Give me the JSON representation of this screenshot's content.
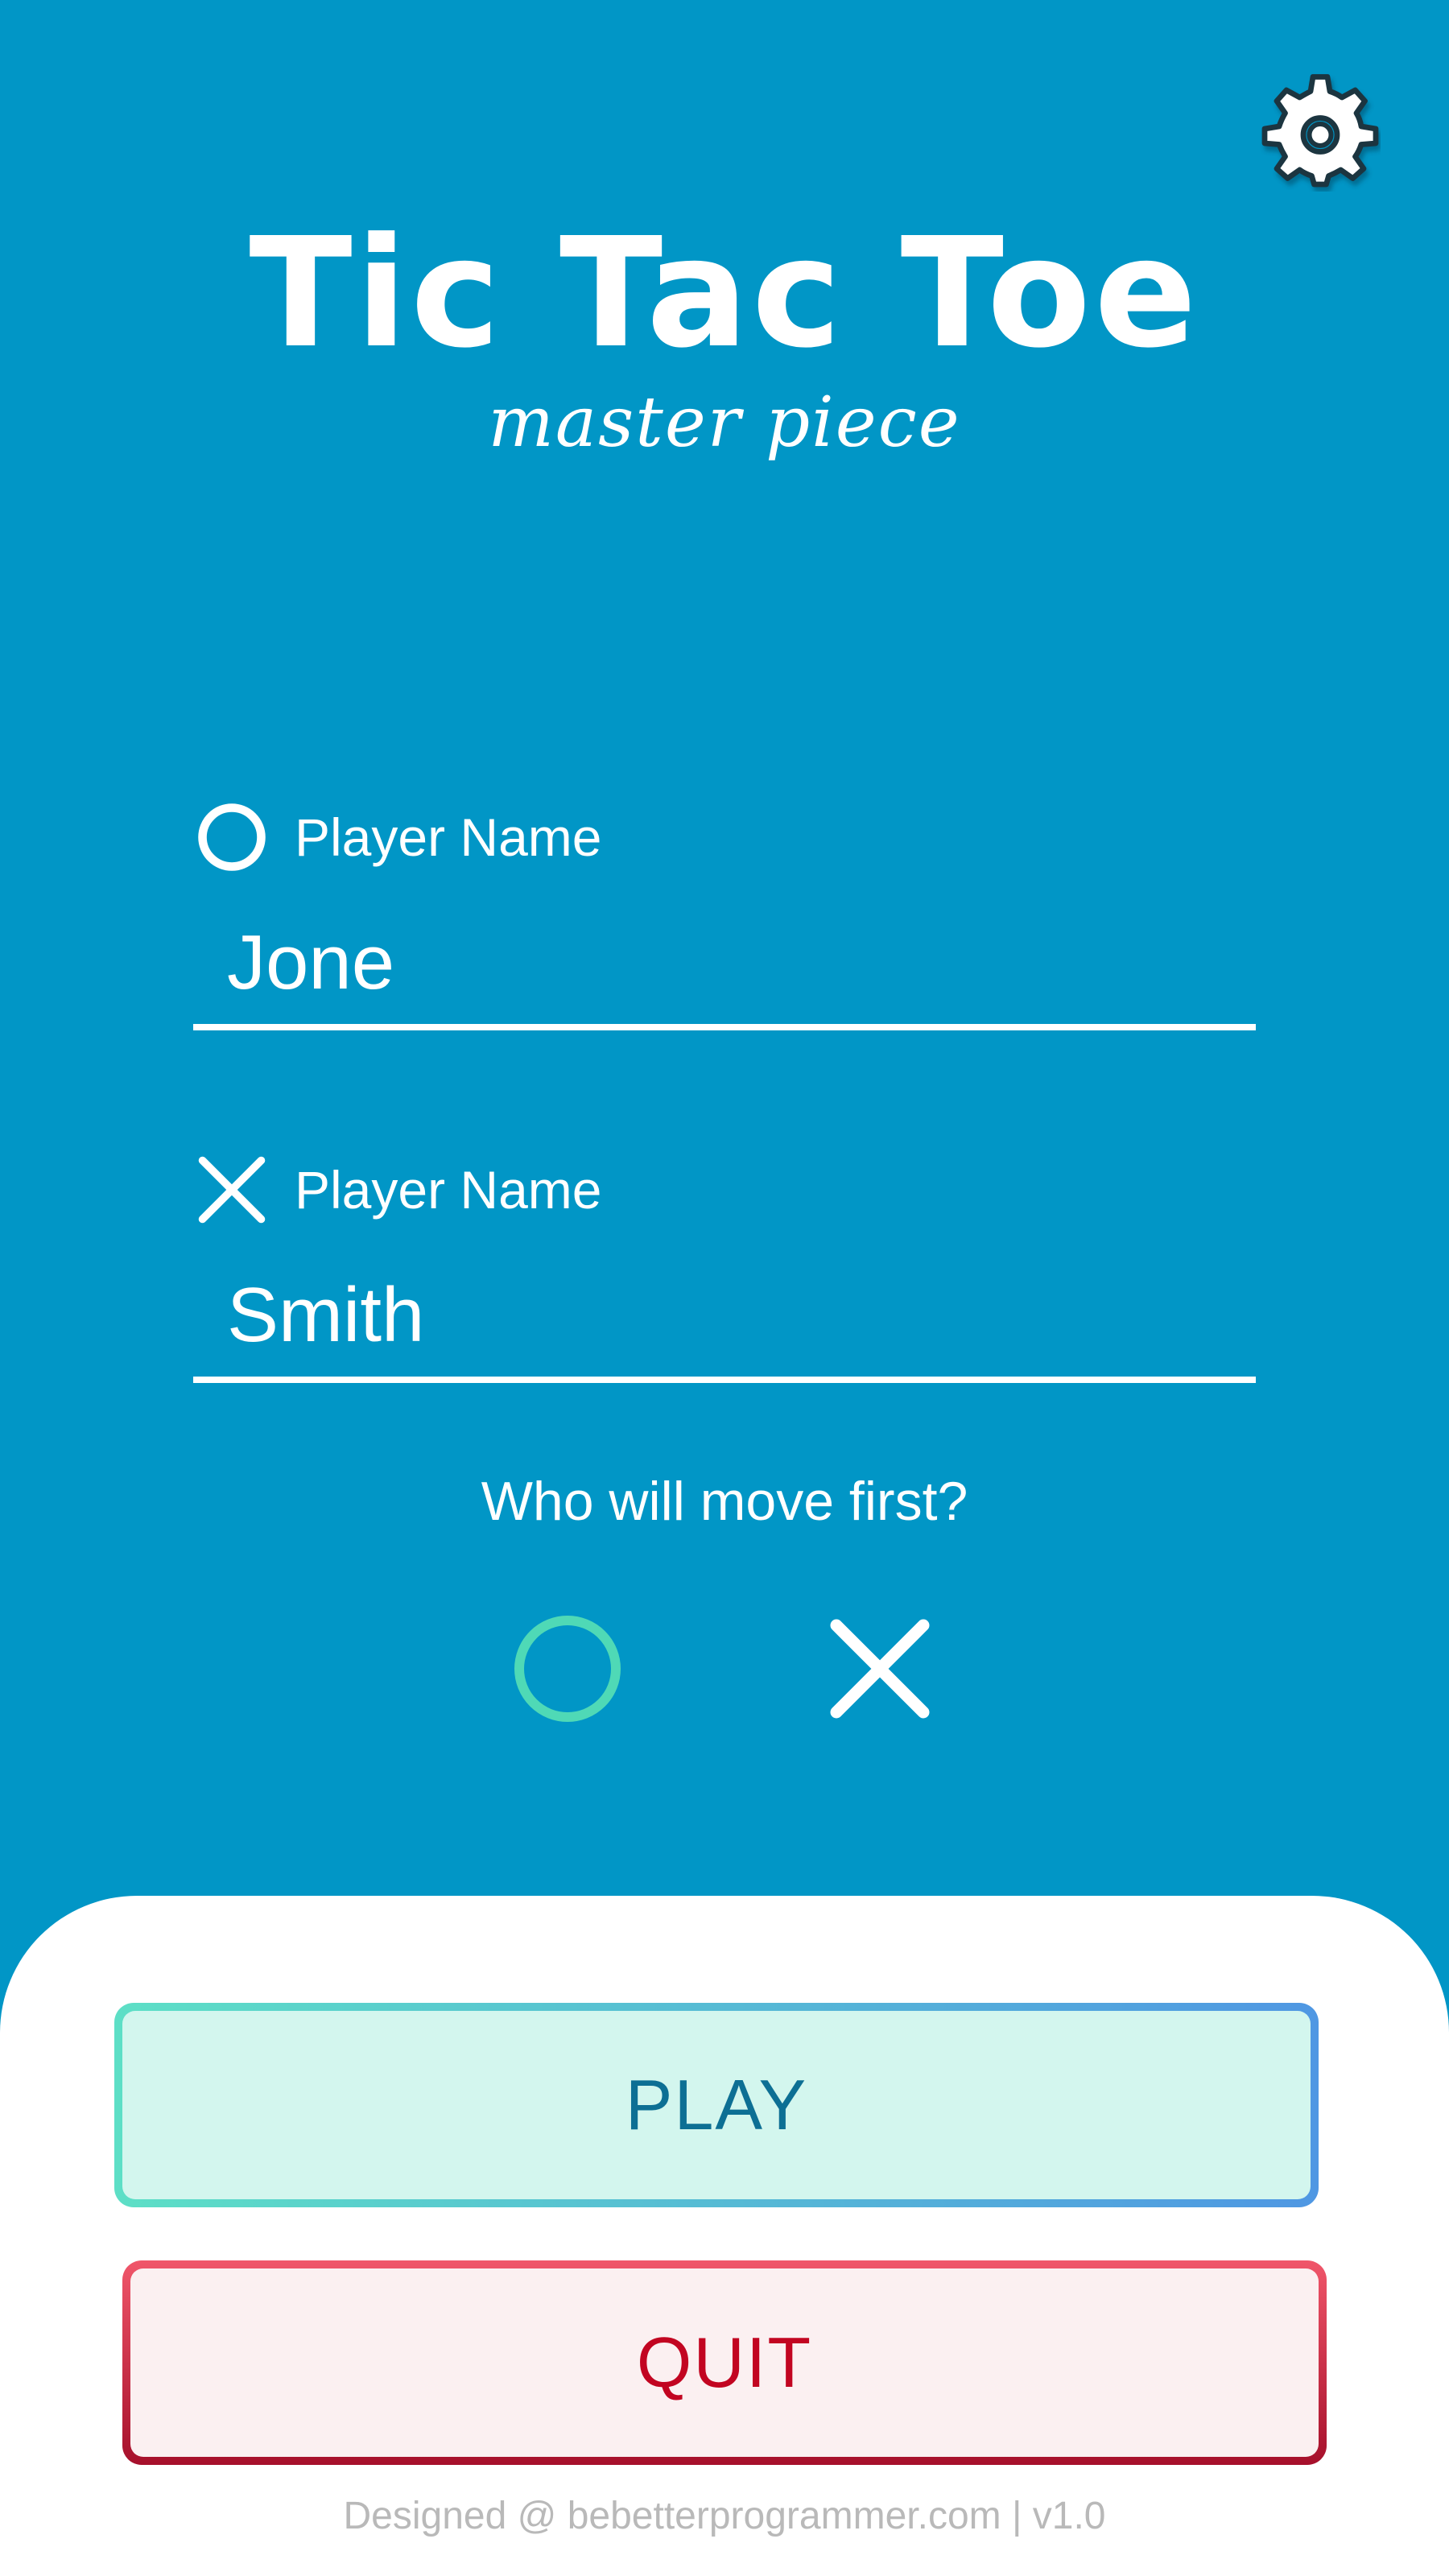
{
  "app": {
    "title": "Tic Tac Toe",
    "subtitle": "master piece"
  },
  "header": {
    "settings_icon": "gear-icon"
  },
  "players": [
    {
      "symbol": "circle-icon",
      "label": "Player Name",
      "value": "Jone"
    },
    {
      "symbol": "cross-icon",
      "label": "Player Name",
      "value": "Smith"
    }
  ],
  "first_move": {
    "question": "Who will move first?",
    "options": [
      {
        "symbol": "circle-icon",
        "selected": true,
        "color": "#4fd9b6"
      },
      {
        "symbol": "cross-icon",
        "selected": false,
        "color": "#ffffff"
      }
    ]
  },
  "actions": {
    "play_label": "PLAY",
    "quit_label": "QUIT"
  },
  "footer": {
    "text": "Designed @ bebetterprogrammer.com | v1.0"
  },
  "colors": {
    "background": "#0196c6",
    "play_text": "#0d6f94",
    "quit_text": "#c20521",
    "selected_accent": "#4fd9b6"
  }
}
